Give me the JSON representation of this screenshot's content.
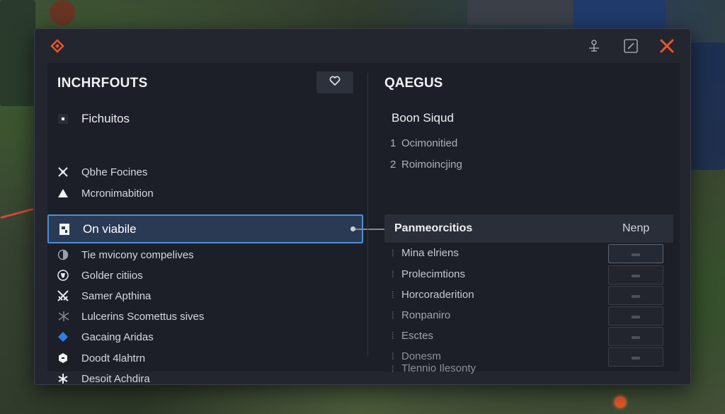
{
  "window": {
    "left_panel": {
      "title": "INCHRFOUTS",
      "items": [
        {
          "label": "Fichuitos",
          "icon": "square-dot-icon"
        },
        {
          "label": "Qbhe Focines",
          "icon": "crossed-tools-icon"
        },
        {
          "label": "Mcronimabition",
          "icon": "triangle-icon"
        },
        {
          "label": "On viabile",
          "icon": "card-icon",
          "selected": true
        },
        {
          "label": "Tie mvicony compelives",
          "icon": "half-circle-icon"
        },
        {
          "label": "Golder citiios",
          "icon": "shield-icon"
        },
        {
          "label": "Samer Apthina",
          "icon": "crossed-swords-icon"
        },
        {
          "label": "Lulcerins Scomettus sives",
          "icon": "spark-icon"
        },
        {
          "label": "Gacaing Aridas",
          "icon": "blue-diamond-icon"
        },
        {
          "label": "Doodt 4lahtrn",
          "icon": "hexagon-icon"
        },
        {
          "label": "Desoit Achdira",
          "icon": "star-cross-icon"
        }
      ]
    },
    "right_panel": {
      "title": "QAEGUS",
      "heading": "Boon Siqud",
      "numbered": [
        {
          "n": "1",
          "label": "Ocimonitied"
        },
        {
          "n": "2",
          "label": "Roimoincjing"
        }
      ],
      "section": {
        "label": "Panmeorcitios",
        "column": "Nenp"
      },
      "rows": [
        {
          "label": "Mina elriens"
        },
        {
          "label": "Prolecimtions"
        },
        {
          "label": "Horcoraderition"
        },
        {
          "label": "Ronpaniro"
        },
        {
          "label": "Esctes"
        },
        {
          "label": "Donesm"
        },
        {
          "label": "Tlennio Ilesonty"
        }
      ]
    }
  },
  "colors": {
    "accent_red": "#e8552a",
    "selection_border": "#4c8ed6",
    "selection_fill": "#2a3a55",
    "panel_bg": "#1c1f27"
  }
}
